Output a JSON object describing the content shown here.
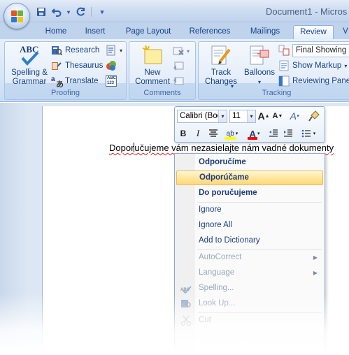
{
  "window": {
    "title": "Document1 - Micros"
  },
  "quick_access": {
    "save": "save-icon",
    "undo": "undo-icon",
    "redo": "redo-icon",
    "customize": "▾"
  },
  "tabs": [
    "Home",
    "Insert",
    "Page Layout",
    "References",
    "Mailings",
    "Review",
    "V"
  ],
  "active_tab": "Review",
  "ribbon": {
    "proofing": {
      "label": "Proofing",
      "spelling": "Spelling &\nGrammar",
      "research": "Research",
      "thesaurus": "Thesaurus",
      "translate": "Translate",
      "abc_icon_text": "ABC",
      "abc123_icon_text": "ABC\n123"
    },
    "comments": {
      "label": "Comments",
      "new_comment": "New\nComment"
    },
    "tracking": {
      "label": "Tracking",
      "track_changes": "Track\nChanges",
      "balloons": "Balloons",
      "final_showing": "Final Showing",
      "show_markup": "Show Markup",
      "reviewing_pane": "Reviewing Pane"
    }
  },
  "mini_toolbar": {
    "font": "Calibri (Boc",
    "size": "11",
    "grow": "A",
    "shrink": "A",
    "bold": "B",
    "italic": "I",
    "highlight_text": "ab",
    "font_color_text": "A"
  },
  "document": {
    "text_before_caret": "Dopor",
    "text_after_caret": "učujeme vám nezasielajte nám vadné dokumenty"
  },
  "context_menu": {
    "suggestions": [
      "Odporučíme",
      "Odporúčame",
      "Do poručujeme"
    ],
    "highlighted_index": 1,
    "ignore": "Ignore",
    "ignore_all": "Ignore All",
    "add_to_dictionary": "Add to Dictionary",
    "autocorrect": "AutoCorrect",
    "language": "Language",
    "spelling": "Spelling...",
    "look_up": "Look Up...",
    "cut": "Cut",
    "spelling_icon_text": "ABC"
  },
  "colors": {
    "ribbon_bg": "#d7e6f8",
    "label_text": "#15428b",
    "highlight": "#ffe59a",
    "spelling_squiggle": "#e02020",
    "font_color_bar": "#ff0000",
    "highlight_bar": "#ffff00"
  }
}
